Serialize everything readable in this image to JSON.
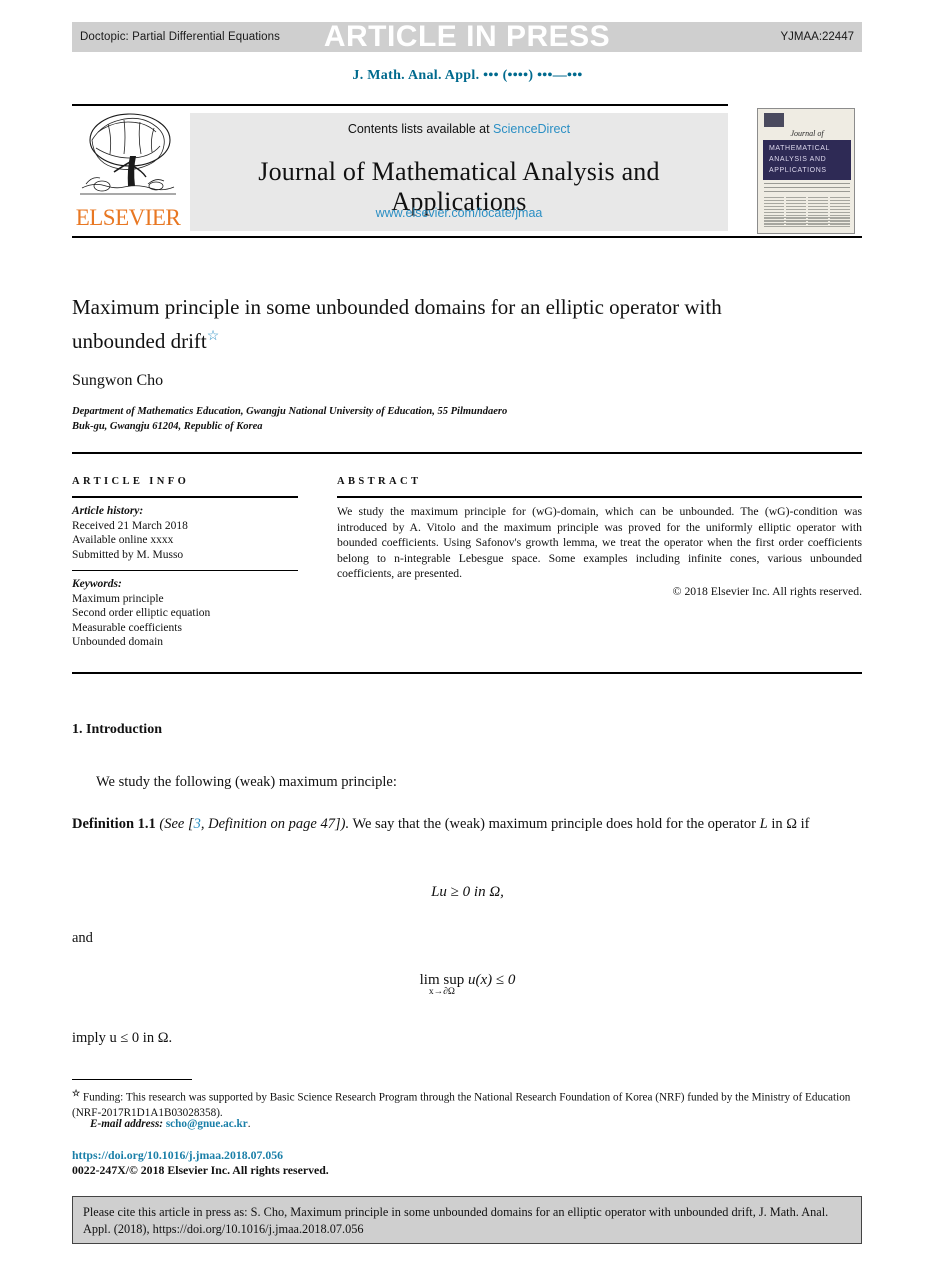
{
  "topbar": {
    "doctopic": "Doctopic: Partial Differential Equations",
    "stamp": "ARTICLE IN PRESS",
    "article_number": "YJMAA:22447",
    "bg_color": "#cfcfcf"
  },
  "journal_line": "J. Math. Anal. Appl. ••• (••••) •••—•••",
  "masthead": {
    "contents_prefix": "Contents lists available at ",
    "sciencedirect": "ScienceDirect",
    "journal_title": "Journal of Mathematical Analysis and Applications",
    "homepage_url": "www.elsevier.com/locate/jmaa",
    "publisher_wordmark": "ELSEVIER",
    "brand_orange": "#e87722",
    "link_blue": "#2b8fc4",
    "panel_bg": "#e8e8e8"
  },
  "cover": {
    "journal_of": "Journal of",
    "band_text": "MATHEMATICAL ANALYSIS AND APPLICATIONS",
    "band_color": "#2e2a55"
  },
  "article": {
    "title": "Maximum principle in some unbounded domains for an elliptic operator with unbounded drift",
    "title_footnote_marker": "☆",
    "author": "Sungwon Cho",
    "affiliation_line1": "Department of Mathematics Education, Gwangju National University of Education, 55 Pilmundaero",
    "affiliation_line2": "Buk-gu, Gwangju 61204, Republic of Korea"
  },
  "article_info": {
    "heading": "ARTICLE INFO",
    "history_label": "Article history:",
    "history": [
      "Received 21 March 2018",
      "Available online xxxx",
      "Submitted by M. Musso"
    ],
    "keywords_label": "Keywords:",
    "keywords": [
      "Maximum principle",
      "Second order elliptic equation",
      "Measurable coefficients",
      "Unbounded domain"
    ]
  },
  "abstract": {
    "heading": "ABSTRACT",
    "text": "We study the maximum principle for (wG)-domain, which can be unbounded. The (wG)-condition was introduced by A. Vitolo and the maximum principle was proved for the uniformly elliptic operator with bounded coefficients. Using Safonov's growth lemma, we treat the operator when the first order coefficients belong to n-integrable Lebesgue space. Some examples including infinite cones, various unbounded coefficients, are presented.",
    "copyright": "© 2018 Elsevier Inc. All rights reserved."
  },
  "body": {
    "section_heading": "1. Introduction",
    "paragraph1": "We study the following (weak) maximum principle:",
    "definition_label": "Definition 1.1",
    "definition_see_open": "(See [",
    "definition_ref": "3",
    "definition_see_close": ", Definition on page 47]).",
    "definition_text_a": "We say that the (weak) maximum principle does hold for",
    "definition_text_b": "the operator",
    "definition_operator": "L",
    "definition_text_c": "in Ω if",
    "equation1": "Lu ≥ 0     in Ω,",
    "equation_and": "and",
    "equation2_main": "lim sup",
    "equation2_sub": "x→∂Ω",
    "equation2_tail": "u(x) ≤ 0",
    "equation_imply": "imply u ≤ 0 in Ω."
  },
  "footnotes": {
    "funding_marker": "☆",
    "funding": "Funding: This research was supported by Basic Science Research Program through the National Research Foundation of Korea (NRF) funded by the Ministry of Education (NRF-2017R1D1A1B03028358).",
    "email_label": "E-mail address:",
    "email": "scho@gnue.ac.kr",
    "email_period": ".",
    "doi": "https://doi.org/10.1016/j.jmaa.2018.07.056",
    "issn_copyright": "0022-247X/© 2018 Elsevier Inc. All rights reserved."
  },
  "cite_box": {
    "text": "Please cite this article in press as: S. Cho, Maximum principle in some unbounded domains for an elliptic operator with unbounded drift, J. Math. Anal. Appl. (2018), https://doi.org/10.1016/j.jmaa.2018.07.056",
    "bg_color": "#cfcfcf"
  }
}
